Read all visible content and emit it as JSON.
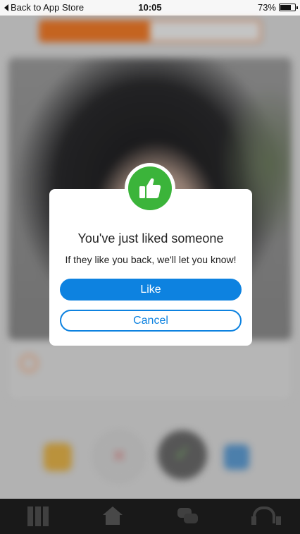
{
  "status_bar": {
    "back_label": "Back to App Store",
    "time": "10:05",
    "battery_percent": "73%",
    "battery_level": 0.73
  },
  "modal": {
    "icon": "thumbs-up-icon",
    "title": "You've just liked someone",
    "message": "If they like you back, we'll let you know!",
    "like_label": "Like",
    "cancel_label": "Cancel"
  },
  "colors": {
    "accent_blue": "#0d82e0",
    "badge_green": "#3bb43a",
    "brand_orange": "#ef7a28"
  },
  "tab_bar": {
    "tabs": [
      "grid-icon",
      "home-icon",
      "chat-icon",
      "support-icon"
    ]
  }
}
